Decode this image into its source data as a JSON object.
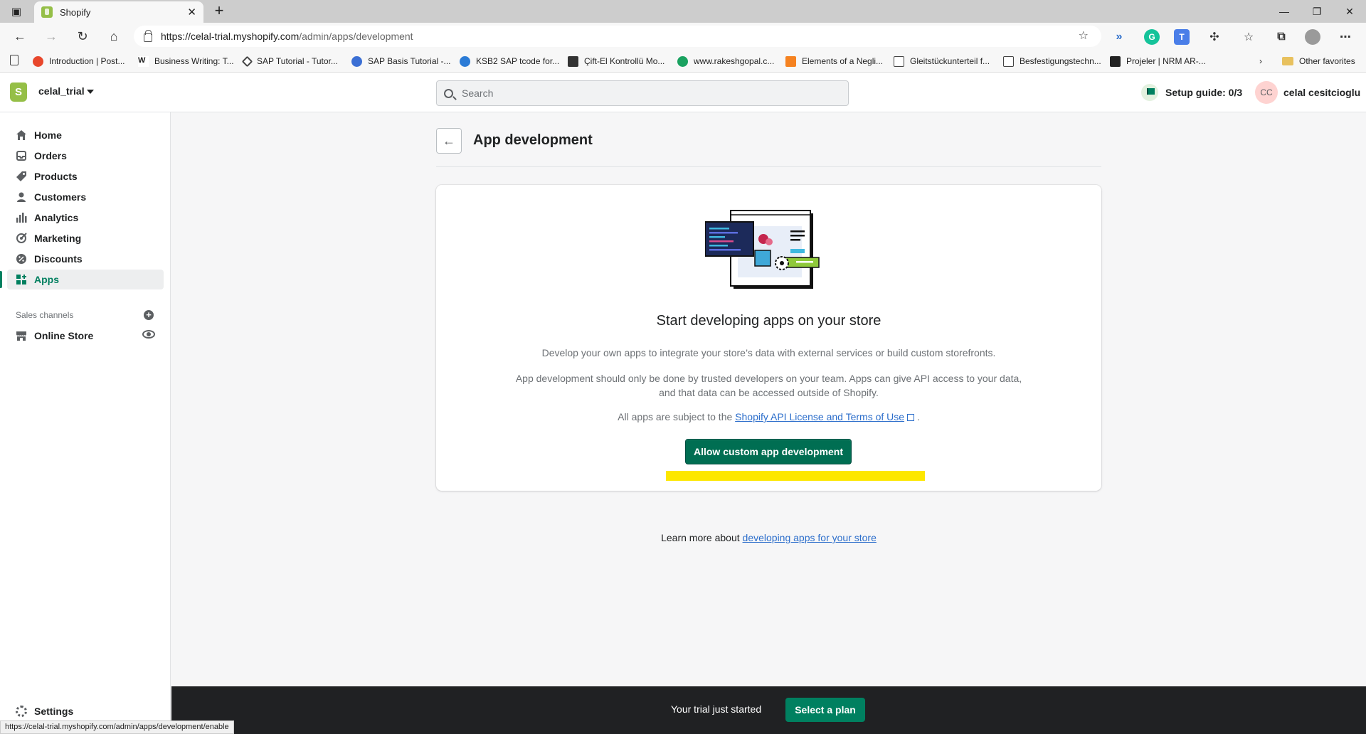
{
  "browser": {
    "tab_title": "Shopify",
    "url_host": "https://celal-trial.myshopify.com",
    "url_path": "/admin/apps/development",
    "bookmarks": [
      "Introduction | Post...",
      "Business Writing: T...",
      "SAP Tutorial - Tutor...",
      "SAP Basis Tutorial -...",
      "KSB2 SAP tcode for...",
      "Çift-El Kontrollü Mo...",
      "www.rakeshgopal.c...",
      "Elements of a Negli...",
      "Gleitstückunterteil f...",
      "Besfestigungstechn...",
      "Projeler | NRM AR-..."
    ],
    "other_favorites": "Other favorites",
    "status_url": "https://celal-trial.myshopify.com/admin/apps/development/enable"
  },
  "topbar": {
    "store_name": "celal_trial",
    "search_placeholder": "Search",
    "setup_guide": "Setup guide: 0/3",
    "user_initials": "CC",
    "user_name": "celal cesitcioglu"
  },
  "sidebar": {
    "items": [
      {
        "label": "Home",
        "icon": "home-icon"
      },
      {
        "label": "Orders",
        "icon": "orders-icon"
      },
      {
        "label": "Products",
        "icon": "tag-icon"
      },
      {
        "label": "Customers",
        "icon": "person-icon"
      },
      {
        "label": "Analytics",
        "icon": "bar-chart-icon"
      },
      {
        "label": "Marketing",
        "icon": "target-icon"
      },
      {
        "label": "Discounts",
        "icon": "discount-icon"
      },
      {
        "label": "Apps",
        "icon": "apps-grid-icon"
      }
    ],
    "sales_channels_label": "Sales channels",
    "online_store": "Online Store",
    "settings": "Settings"
  },
  "page": {
    "title": "App development",
    "card_heading": "Start developing apps on your store",
    "p1": "Develop your own apps to integrate your store’s data with external services or build custom storefronts.",
    "p2": "App development should only be done by trusted developers on your team. Apps can give API access to your data, and that data can be accessed outside of Shopify.",
    "p3_prefix": "All apps are subject to the",
    "p3_link": "Shopify API License and Terms of Use",
    "p3_suffix": ".",
    "primary_button": "Allow custom app development",
    "learn_more_prefix": "Learn more about",
    "learn_more_link": "developing apps for your store"
  },
  "trial": {
    "text": "Your trial just started",
    "button": "Select a plan"
  },
  "colors": {
    "brand_green": "#008060",
    "primary_button": "#006e52",
    "link": "#2c6ecb",
    "highlight": "#fde700",
    "trial_bar": "#202123"
  }
}
